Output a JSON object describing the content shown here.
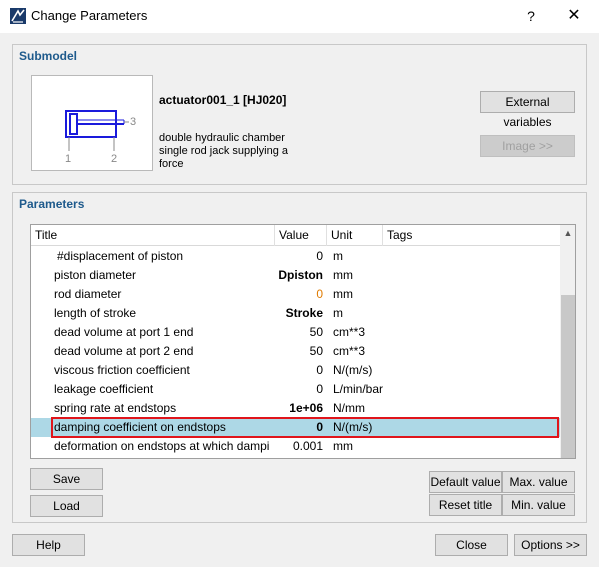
{
  "window": {
    "title": "Change Parameters",
    "help_glyph": "?",
    "close_glyph": "✕"
  },
  "submodel": {
    "heading": "Submodel",
    "name": "actuator001_1 [HJ020]",
    "description_lines": [
      "double hydraulic chamber",
      "single rod jack supplying a",
      "force"
    ],
    "port_labels": [
      "1",
      "2",
      "3"
    ],
    "external_variables_label": "External variables",
    "image_label": "Image >>"
  },
  "parameters": {
    "heading": "Parameters",
    "columns": [
      "Title",
      "Value",
      "Unit",
      "Tags"
    ],
    "rows": [
      {
        "title": "#displacement of piston",
        "value": "0",
        "unit": "m",
        "style": "normal",
        "indent": true
      },
      {
        "title": "piston diameter",
        "value": "Dpiston",
        "unit": "mm",
        "style": "bold"
      },
      {
        "title": "rod diameter",
        "value": "0",
        "unit": "mm",
        "style": "orange"
      },
      {
        "title": "length of stroke",
        "value": "Stroke",
        "unit": "m",
        "style": "bold"
      },
      {
        "title": "dead volume at port 1 end",
        "value": "50",
        "unit": "cm**3",
        "style": "normal"
      },
      {
        "title": "dead volume at port 2 end",
        "value": "50",
        "unit": "cm**3",
        "style": "normal"
      },
      {
        "title": "viscous friction coefficient",
        "value": "0",
        "unit": "N/(m/s)",
        "style": "normal"
      },
      {
        "title": "leakage coefficient",
        "value": "0",
        "unit": "L/min/bar",
        "style": "normal"
      },
      {
        "title": "spring rate at endstops",
        "value": "1e+06",
        "unit": "N/mm",
        "style": "bold"
      },
      {
        "title": "damping coefficient on endstops",
        "value": "0",
        "unit": "N/(m/s)",
        "style": "bold",
        "selected": true
      },
      {
        "title": "deformation on endstops at which dampin...",
        "value": "0.001",
        "unit": "mm",
        "style": "normal"
      }
    ],
    "scroll_up_glyph": "▲",
    "save_label": "Save",
    "load_label": "Load",
    "default_value_label": "Default value",
    "max_value_label": "Max. value",
    "reset_title_label": "Reset title",
    "min_value_label": "Min. value"
  },
  "footer": {
    "help_label": "Help",
    "close_label": "Close",
    "options_label": "Options >>"
  },
  "colors": {
    "accent": "#1e5a8c",
    "selection": "#add8e6",
    "highlight_border": "#e0151b",
    "orange_value": "#e07b00"
  }
}
